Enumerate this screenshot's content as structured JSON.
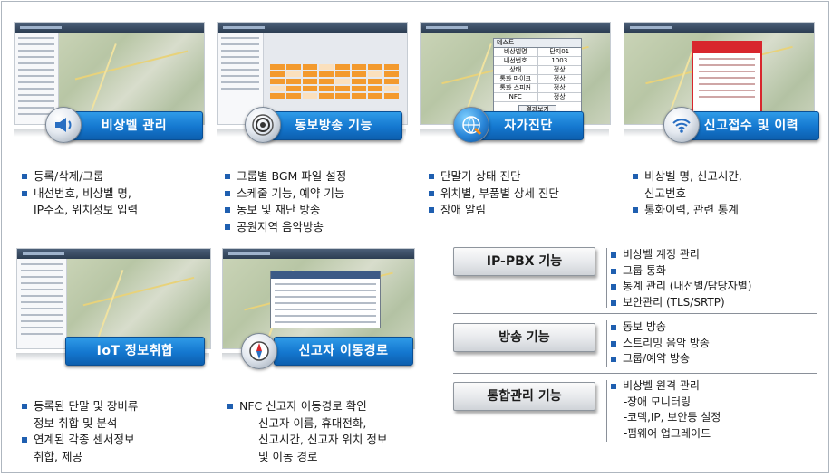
{
  "features": [
    {
      "title": "비상벨 관리",
      "icon": "speaker-icon",
      "items": [
        "등록/삭제/그룹",
        "내선번호, 비상벨 명,",
        "IP주소, 위치정보 입력"
      ]
    },
    {
      "title": "동보방송 기능",
      "icon": "broadcast-icon",
      "items": [
        "그룹별 BGM 파일 설정",
        "스케줄 기능, 예약 기능",
        "동보 및 재난 방송",
        "공원지역 음악방송"
      ]
    },
    {
      "title": "자가진단",
      "icon": "globe-diagnosis-icon",
      "items": [
        "단말기 상태 진단",
        "위치별, 부품별 상세 진단",
        "장애 알림"
      ]
    },
    {
      "title": "신고접수 및 이력",
      "icon": "wifi-report-icon",
      "items": [
        "비상벨 명, 신고시간,",
        "신고번호",
        "통화이력, 관련 통계"
      ]
    },
    {
      "title": "IoT 정보취합",
      "icon": "",
      "items": [
        "등록된 단말 및 장비류",
        "정보 취합 및 분석",
        "연계된 각종 센서정보",
        "취합, 제공"
      ]
    },
    {
      "title": "신고자 이동경로",
      "icon": "compass-icon",
      "items": [
        "NFC 신고자 이동경로 확인",
        "신고자 이름, 휴대전화,",
        "신고시간, 신고자 위치 정보",
        "및 이동 경로"
      ]
    }
  ],
  "sections": [
    {
      "label": "IP-PBX 기능",
      "items": [
        "비상벨 계정 관리",
        "그룹 통화",
        "통계 관리 (내선별/담당자별)",
        "보안관리 (TLS/SRTP)"
      ]
    },
    {
      "label": "방송 기능",
      "items": [
        "동보 방송",
        "스트리밍 음악 방송",
        "그룹/예약 방송"
      ]
    },
    {
      "label": "통합관리 기능",
      "items": [
        "비상벨 원격 관리"
      ],
      "subitems": [
        "장애 모니터링",
        "코덱,IP, 보안등 설정",
        "펌웨어 업그레이드"
      ]
    }
  ],
  "diagnosis_table": {
    "title": "테스트",
    "rows": [
      [
        "비상벨명",
        "단지01"
      ],
      [
        "내선번호",
        "1003"
      ],
      [
        "상태",
        "정상"
      ],
      [
        "통화 마이크",
        "정상"
      ],
      [
        "통화 스피커",
        "정상"
      ],
      [
        "NFC",
        "정상"
      ]
    ],
    "button": "결과보기"
  },
  "colors": {
    "badge_blue": "#1477cf",
    "bullet_blue": "#1f5fb0",
    "grid_orange": "#f39a2e",
    "alert_red": "#d8262d"
  }
}
